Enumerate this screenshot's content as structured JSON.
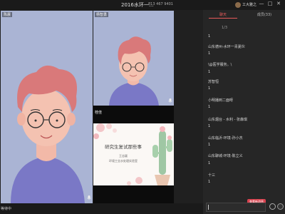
{
  "window": {
    "title": "2016水环一...",
    "meeting_id": "813 467 9401",
    "rec_label": "",
    "user_name": "工大雅之",
    "controls": [
      "—",
      "□",
      "✕"
    ]
  },
  "videos": {
    "main_name": "陈晨",
    "tr_name": "杨智勇",
    "gap_name": "桂佳"
  },
  "slide": {
    "title": "研究生复试那些事",
    "author": "王志颖",
    "org": "环境工业水处理实验室"
  },
  "status": {
    "text": "等待中"
  },
  "chat": {
    "tabs": [
      "聊天",
      "成员(33)"
    ],
    "messages": [
      {
        "kind": "text",
        "text": "1/3"
      },
      {
        "kind": "num",
        "text": "1"
      },
      {
        "kind": "text",
        "text": "山东德州-水环一青夏伙"
      },
      {
        "kind": "num",
        "text": "1"
      },
      {
        "kind": "text",
        "text": "\\@医学服务。\\"
      },
      {
        "kind": "num",
        "text": "1"
      },
      {
        "kind": "text",
        "text": "苏智恒"
      },
      {
        "kind": "num",
        "text": "1"
      },
      {
        "kind": "text",
        "text": "小明播到二面呀"
      },
      {
        "kind": "num",
        "text": "1"
      },
      {
        "kind": "text",
        "text": "山东烟台 - 水利 - 张森琪"
      },
      {
        "kind": "num",
        "text": "1"
      },
      {
        "kind": "text",
        "text": "山东临沂-环境-孙小杰"
      },
      {
        "kind": "num",
        "text": "1"
      },
      {
        "kind": "text",
        "text": "山东聊城-环境-陈立义"
      },
      {
        "kind": "num",
        "text": "1"
      },
      {
        "kind": "text",
        "text": "十三"
      },
      {
        "kind": "num",
        "text": "1"
      }
    ],
    "new_messages": "查看新消息"
  }
}
